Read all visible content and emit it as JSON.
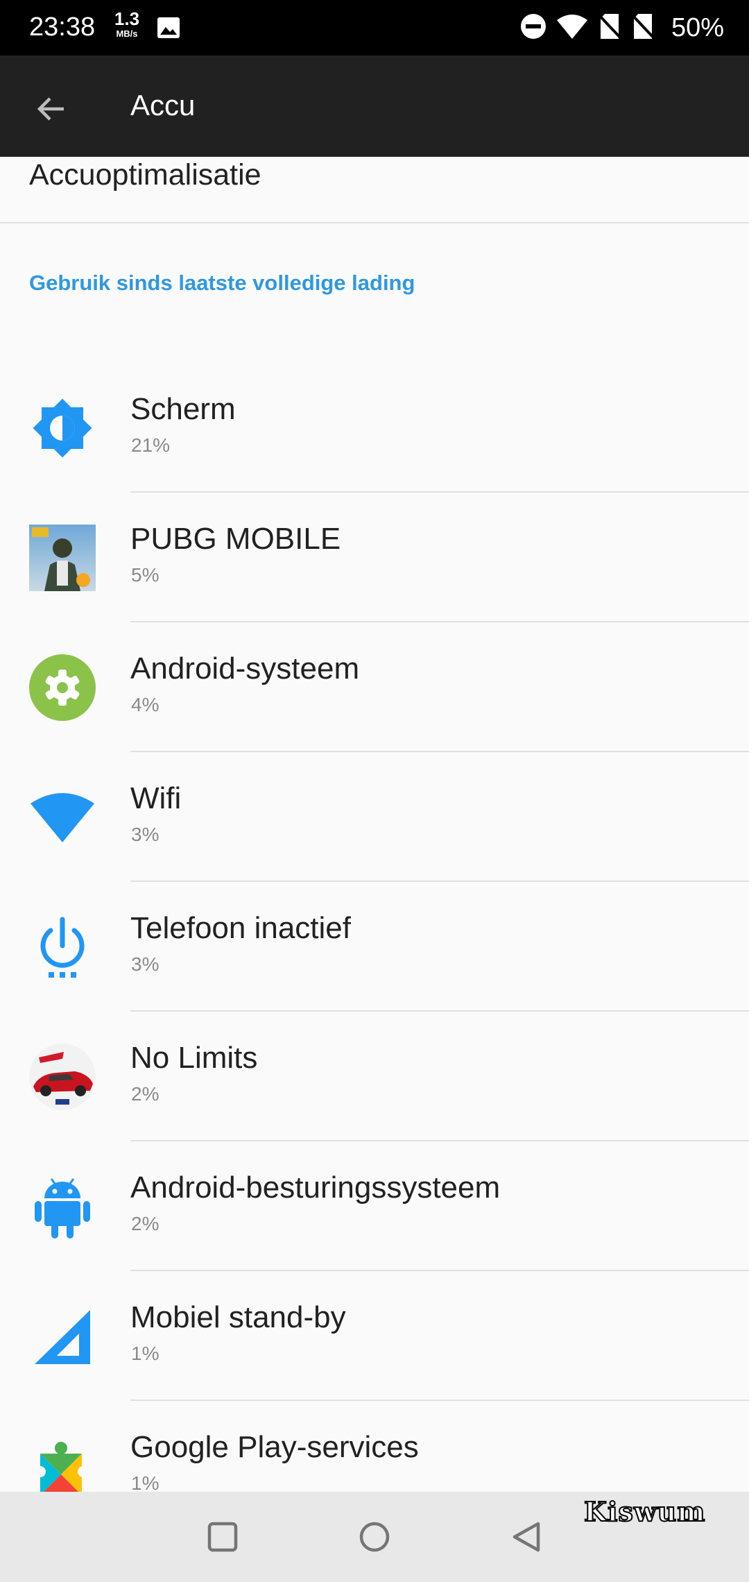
{
  "status_bar": {
    "time": "23:38",
    "net_speed_value": "1.3",
    "net_speed_unit": "MB/s",
    "battery": "50%",
    "icons": [
      "image-icon",
      "dnd-icon",
      "wifi-icon",
      "no-sim-icon",
      "no-sim-icon"
    ]
  },
  "app_bar": {
    "title": "Accu",
    "back_icon": "arrow-back-icon"
  },
  "optimization_label": "Accuoptimalisatie",
  "section_header": "Gebruik sinds laatste volledige lading",
  "usage_items": [
    {
      "name": "Scherm",
      "percent": "21%",
      "icon": "brightness-icon"
    },
    {
      "name": "PUBG MOBILE",
      "percent": "5%",
      "icon": "pubg-app-icon"
    },
    {
      "name": "Android-systeem",
      "percent": "4%",
      "icon": "settings-gear-icon"
    },
    {
      "name": "Wifi",
      "percent": "3%",
      "icon": "wifi-icon"
    },
    {
      "name": "Telefoon inactief",
      "percent": "3%",
      "icon": "power-idle-icon"
    },
    {
      "name": "No Limits",
      "percent": "2%",
      "icon": "nfs-no-limits-app-icon"
    },
    {
      "name": "Android-besturingssysteem",
      "percent": "2%",
      "icon": "android-robot-icon"
    },
    {
      "name": "Mobiel stand-by",
      "percent": "1%",
      "icon": "cell-signal-icon"
    },
    {
      "name": "Google Play-services",
      "percent": "1%",
      "icon": "google-play-services-icon"
    }
  ],
  "nav_bar": {
    "buttons": [
      "recents-icon",
      "home-icon",
      "back-icon"
    ]
  },
  "watermark": "Kiswum",
  "colors": {
    "accent": "#2f98e0",
    "icon_blue": "#2196f3",
    "android_system_green": "#8bc34a",
    "app_bar": "#212121",
    "background": "#fafafa"
  }
}
